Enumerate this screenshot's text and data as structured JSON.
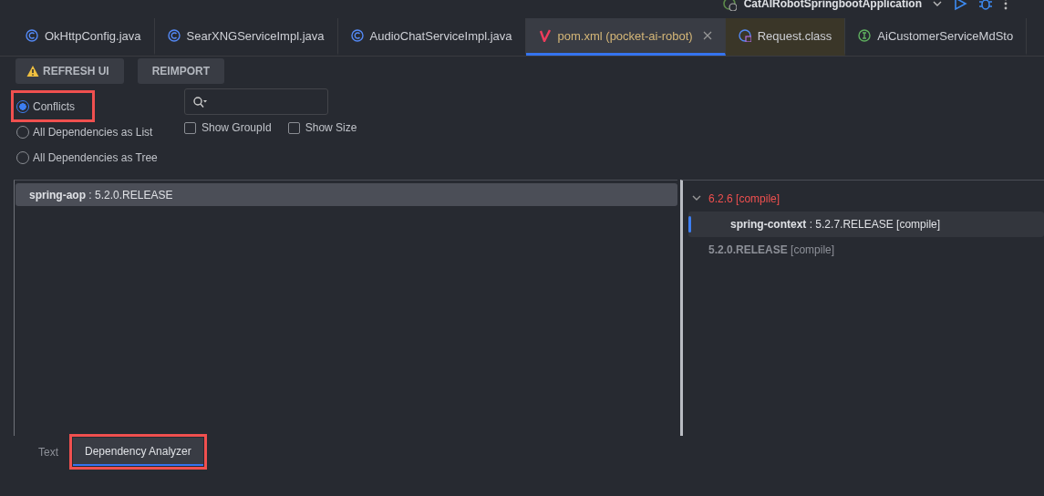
{
  "toolbar": {
    "run_config": "CatAIRobotSpringbootApplication"
  },
  "editor_tabs": [
    {
      "label": "OkHttpConfig.java",
      "kind": "class",
      "selected": false
    },
    {
      "label": "SearXNGServiceImpl.java",
      "kind": "class",
      "selected": false
    },
    {
      "label": "AudioChatServiceImpl.java",
      "kind": "class",
      "selected": false
    },
    {
      "label": "pom.xml (pocket-ai-robot)",
      "kind": "maven",
      "selected": true,
      "closable": true
    },
    {
      "label": "Request.class",
      "kind": "compiled",
      "selected": false
    },
    {
      "label": "AiCustomerServiceMdSto",
      "kind": "interface",
      "selected": false
    }
  ],
  "actions": [
    {
      "label": "REFRESH UI",
      "warning": true
    },
    {
      "label": "REIMPORT",
      "warning": false
    }
  ],
  "view_modes": [
    {
      "label": "Conflicts",
      "selected": true,
      "highlighted": true
    },
    {
      "label": "All Dependencies as List",
      "selected": false,
      "highlighted": false
    },
    {
      "label": "All Dependencies as Tree",
      "selected": false,
      "highlighted": false
    }
  ],
  "options": [
    {
      "label": "Show GroupId",
      "checked": false
    },
    {
      "label": "Show Size",
      "checked": false
    }
  ],
  "conflicts": [
    {
      "name": "spring-aop",
      "separator": ":",
      "version": "5.2.0.RELEASE",
      "selected": true
    }
  ],
  "usages": [
    {
      "version": "6.2.6",
      "scope": "[compile]",
      "conflict": true,
      "expanded": true,
      "children": [
        {
          "name": "spring-context",
          "separator": ":",
          "version": "5.2.7.RELEASE",
          "scope": "[compile]",
          "selected": true
        }
      ]
    },
    {
      "version": "5.2.0.RELEASE",
      "scope": "[compile]",
      "conflict": false
    }
  ],
  "bottom_tabs": [
    {
      "label": "Text",
      "selected": false,
      "highlighted": false
    },
    {
      "label": "Dependency Analyzer",
      "selected": true,
      "highlighted": true
    }
  ]
}
